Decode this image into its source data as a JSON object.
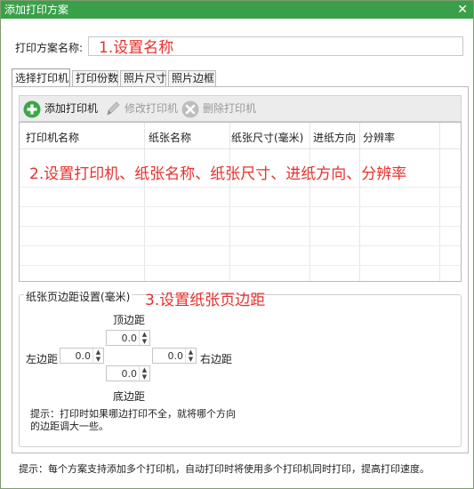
{
  "window": {
    "title": "添加打印方案",
    "close_glyph": "✕"
  },
  "scheme": {
    "label": "打印方案名称:",
    "value": ""
  },
  "annotations": {
    "a1": "1.设置名称",
    "a2": "2.设置打印机、纸张名称、纸张尺寸、进纸方向、分辨率",
    "a3": "3.设置纸张页边距"
  },
  "tabs": [
    {
      "label": "选择打印机",
      "active": true
    },
    {
      "label": "打印份数"
    },
    {
      "label": "照片尺寸"
    },
    {
      "label": "照片边框"
    }
  ],
  "toolbar": {
    "add": {
      "label": "添加打印机",
      "icon": "add-icon"
    },
    "edit": {
      "label": "修改打印机",
      "icon": "pencil-icon"
    },
    "delete": {
      "label": "删除打印机",
      "icon": "delete-icon"
    }
  },
  "grid": {
    "columns": [
      "打印机名称",
      "纸张名称",
      "纸张尺寸(毫米)",
      "进纸方向",
      "分辨率"
    ]
  },
  "margins": {
    "group_title": "纸张页边距设置(毫米)",
    "top_label": "顶边距",
    "bottom_label": "底边距",
    "left_label": "左边距",
    "right_label": "右边距",
    "top_value": "0.0",
    "bottom_value": "0.0",
    "left_value": "0.0",
    "right_value": "0.0",
    "hint": "提示：打印时如果哪边打印不全，就将哪个方向的边距调大一些。"
  },
  "footer": "提示：每个方案支持添加多个打印机，自动打印时将使用多个打印机同时打印，提高打印速度。",
  "colors": {
    "title_bar": "#39a049",
    "annotation": "#e8302c"
  }
}
